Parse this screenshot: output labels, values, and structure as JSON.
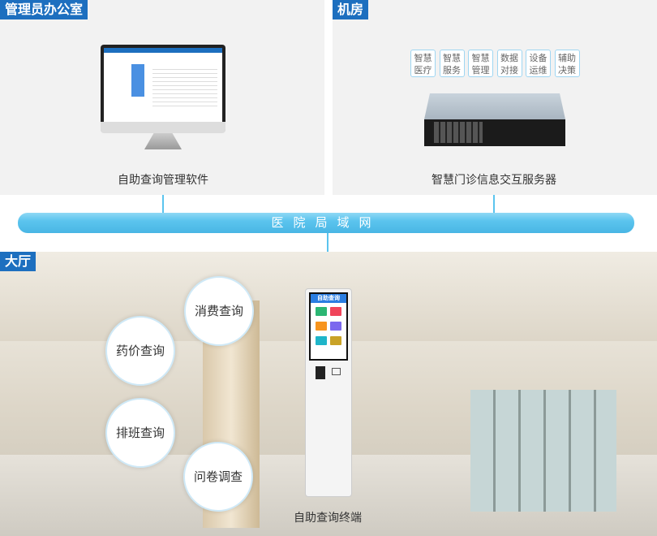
{
  "office": {
    "tag": "管理员办公室",
    "caption": "自助查询管理软件"
  },
  "server_room": {
    "tag": "机房",
    "caption": "智慧门诊信息交互服务器",
    "features": [
      [
        "智慧",
        "医疗"
      ],
      [
        "智慧",
        "服务"
      ],
      [
        "智慧",
        "管理"
      ],
      [
        "数据",
        "对接"
      ],
      [
        "设备",
        "运维"
      ],
      [
        "辅助",
        "决策"
      ]
    ]
  },
  "network": {
    "label": "医院局域网"
  },
  "hall": {
    "tag": "大厅",
    "caption": "自助查询终端",
    "bubbles": [
      "消费查询",
      "药价查询",
      "排班查询",
      "问卷调查"
    ],
    "kiosk_title": "自助查询"
  },
  "colors": {
    "tag": "#1d6fbf",
    "pipe": "#5bc4ee"
  }
}
